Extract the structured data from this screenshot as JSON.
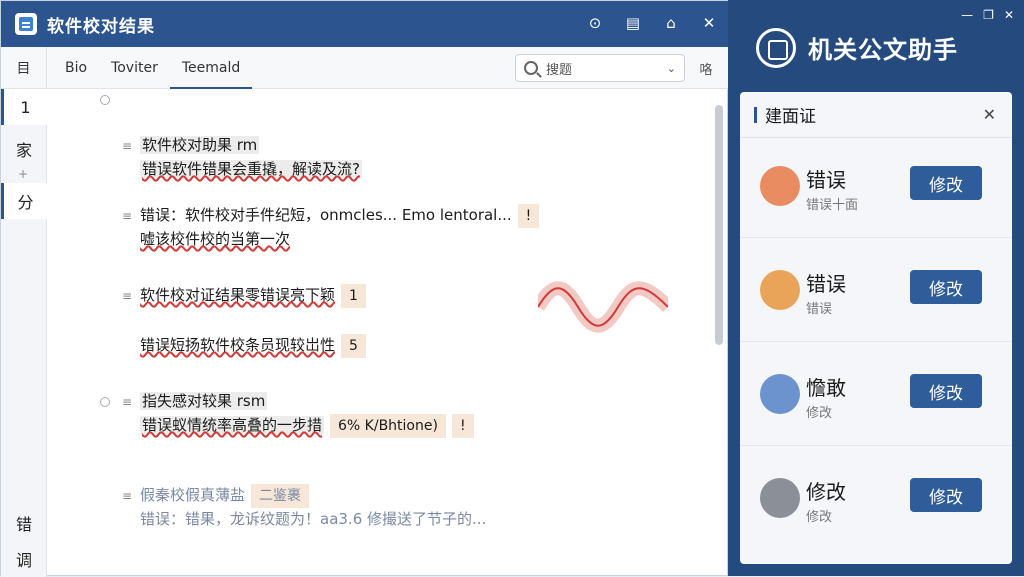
{
  "app": {
    "title": "软件校对结果",
    "icons": [
      "compass-icon",
      "clipboard-icon",
      "tag-icon",
      "close-icon"
    ]
  },
  "toolbar": {
    "left_label": "目",
    "tabs": [
      "Bio",
      "Toviter",
      "Teemald"
    ],
    "search_placeholder": "搜题",
    "right_label": "咯"
  },
  "rail": {
    "items": [
      "1",
      "家",
      "分",
      "错",
      "调"
    ],
    "plus": "+"
  },
  "doc": {
    "p1": {
      "line1": "软件校对助果 rm",
      "line2": "错误软件错果会重撬，解读及流?"
    },
    "p2": {
      "line1": "错误：软件校对手件纪短，onmcles... Emo lentoral...",
      "badge1": "!",
      "line2": "嘘该校件校的当第一次"
    },
    "p3": {
      "line1": "软件校对证结果零错误亮下颖",
      "badge1": "1",
      "line2": "错误短扬软件校条员现较岀性",
      "badge2": "5"
    },
    "p4": {
      "line1": "指失感对较果 rsm",
      "line2": "错误蚁情统率高叠的一步措",
      "badge1": "6% K/Bhtione)",
      "badge2": "!"
    },
    "p5": {
      "line1": "假秦校假真薄盐",
      "badge1": "二鉴裹",
      "line2": "错误：错果，龙诉纹题为！aa3.6 修撮送了节子的..."
    }
  },
  "panel": {
    "title": "机关公文助手",
    "card_title": "建面证",
    "items": [
      {
        "title": "错误",
        "sub": "错误十面",
        "btn": "修改",
        "icon": "document-chart-icon"
      },
      {
        "title": "错误",
        "sub": "错误",
        "btn": "修改",
        "icon": "package-icon"
      },
      {
        "title": "憺敢",
        "sub": "修改",
        "btn": "修改",
        "icon": "edit-arrow-icon"
      },
      {
        "title": "修改",
        "sub": "修改",
        "btn": "修改",
        "icon": "chat-icon"
      }
    ]
  },
  "colors": {
    "titlebar": "#2c5590",
    "panel": "#244a7e",
    "button": "#2f5d99",
    "error_underline": "#d23a3a"
  }
}
